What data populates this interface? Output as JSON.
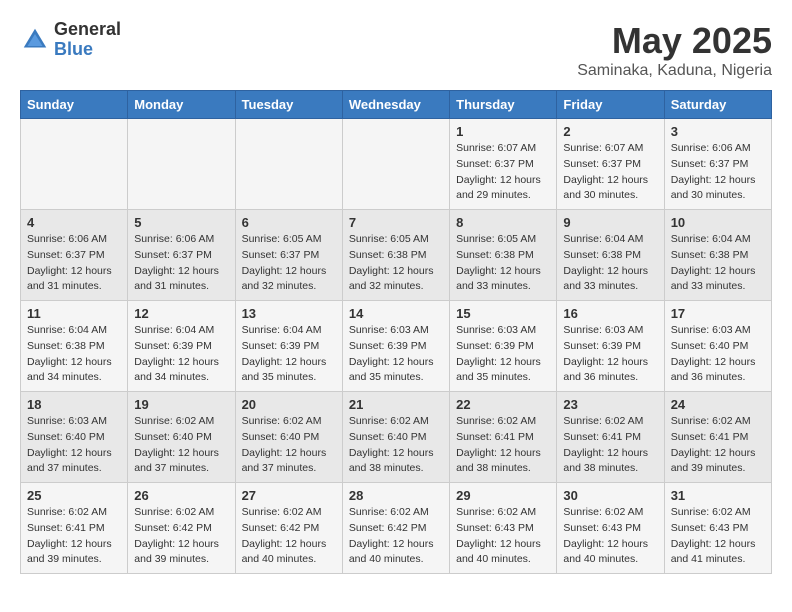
{
  "header": {
    "logo_general": "General",
    "logo_blue": "Blue",
    "month_year": "May 2025",
    "location": "Saminaka, Kaduna, Nigeria"
  },
  "days_of_week": [
    "Sunday",
    "Monday",
    "Tuesday",
    "Wednesday",
    "Thursday",
    "Friday",
    "Saturday"
  ],
  "weeks": [
    [
      {
        "day": "",
        "info": ""
      },
      {
        "day": "",
        "info": ""
      },
      {
        "day": "",
        "info": ""
      },
      {
        "day": "",
        "info": ""
      },
      {
        "day": "1",
        "info": "Sunrise: 6:07 AM\nSunset: 6:37 PM\nDaylight: 12 hours and 29 minutes."
      },
      {
        "day": "2",
        "info": "Sunrise: 6:07 AM\nSunset: 6:37 PM\nDaylight: 12 hours and 30 minutes."
      },
      {
        "day": "3",
        "info": "Sunrise: 6:06 AM\nSunset: 6:37 PM\nDaylight: 12 hours and 30 minutes."
      }
    ],
    [
      {
        "day": "4",
        "info": "Sunrise: 6:06 AM\nSunset: 6:37 PM\nDaylight: 12 hours and 31 minutes."
      },
      {
        "day": "5",
        "info": "Sunrise: 6:06 AM\nSunset: 6:37 PM\nDaylight: 12 hours and 31 minutes."
      },
      {
        "day": "6",
        "info": "Sunrise: 6:05 AM\nSunset: 6:37 PM\nDaylight: 12 hours and 32 minutes."
      },
      {
        "day": "7",
        "info": "Sunrise: 6:05 AM\nSunset: 6:38 PM\nDaylight: 12 hours and 32 minutes."
      },
      {
        "day": "8",
        "info": "Sunrise: 6:05 AM\nSunset: 6:38 PM\nDaylight: 12 hours and 33 minutes."
      },
      {
        "day": "9",
        "info": "Sunrise: 6:04 AM\nSunset: 6:38 PM\nDaylight: 12 hours and 33 minutes."
      },
      {
        "day": "10",
        "info": "Sunrise: 6:04 AM\nSunset: 6:38 PM\nDaylight: 12 hours and 33 minutes."
      }
    ],
    [
      {
        "day": "11",
        "info": "Sunrise: 6:04 AM\nSunset: 6:38 PM\nDaylight: 12 hours and 34 minutes."
      },
      {
        "day": "12",
        "info": "Sunrise: 6:04 AM\nSunset: 6:39 PM\nDaylight: 12 hours and 34 minutes."
      },
      {
        "day": "13",
        "info": "Sunrise: 6:04 AM\nSunset: 6:39 PM\nDaylight: 12 hours and 35 minutes."
      },
      {
        "day": "14",
        "info": "Sunrise: 6:03 AM\nSunset: 6:39 PM\nDaylight: 12 hours and 35 minutes."
      },
      {
        "day": "15",
        "info": "Sunrise: 6:03 AM\nSunset: 6:39 PM\nDaylight: 12 hours and 35 minutes."
      },
      {
        "day": "16",
        "info": "Sunrise: 6:03 AM\nSunset: 6:39 PM\nDaylight: 12 hours and 36 minutes."
      },
      {
        "day": "17",
        "info": "Sunrise: 6:03 AM\nSunset: 6:40 PM\nDaylight: 12 hours and 36 minutes."
      }
    ],
    [
      {
        "day": "18",
        "info": "Sunrise: 6:03 AM\nSunset: 6:40 PM\nDaylight: 12 hours and 37 minutes."
      },
      {
        "day": "19",
        "info": "Sunrise: 6:02 AM\nSunset: 6:40 PM\nDaylight: 12 hours and 37 minutes."
      },
      {
        "day": "20",
        "info": "Sunrise: 6:02 AM\nSunset: 6:40 PM\nDaylight: 12 hours and 37 minutes."
      },
      {
        "day": "21",
        "info": "Sunrise: 6:02 AM\nSunset: 6:40 PM\nDaylight: 12 hours and 38 minutes."
      },
      {
        "day": "22",
        "info": "Sunrise: 6:02 AM\nSunset: 6:41 PM\nDaylight: 12 hours and 38 minutes."
      },
      {
        "day": "23",
        "info": "Sunrise: 6:02 AM\nSunset: 6:41 PM\nDaylight: 12 hours and 38 minutes."
      },
      {
        "day": "24",
        "info": "Sunrise: 6:02 AM\nSunset: 6:41 PM\nDaylight: 12 hours and 39 minutes."
      }
    ],
    [
      {
        "day": "25",
        "info": "Sunrise: 6:02 AM\nSunset: 6:41 PM\nDaylight: 12 hours and 39 minutes."
      },
      {
        "day": "26",
        "info": "Sunrise: 6:02 AM\nSunset: 6:42 PM\nDaylight: 12 hours and 39 minutes."
      },
      {
        "day": "27",
        "info": "Sunrise: 6:02 AM\nSunset: 6:42 PM\nDaylight: 12 hours and 40 minutes."
      },
      {
        "day": "28",
        "info": "Sunrise: 6:02 AM\nSunset: 6:42 PM\nDaylight: 12 hours and 40 minutes."
      },
      {
        "day": "29",
        "info": "Sunrise: 6:02 AM\nSunset: 6:43 PM\nDaylight: 12 hours and 40 minutes."
      },
      {
        "day": "30",
        "info": "Sunrise: 6:02 AM\nSunset: 6:43 PM\nDaylight: 12 hours and 40 minutes."
      },
      {
        "day": "31",
        "info": "Sunrise: 6:02 AM\nSunset: 6:43 PM\nDaylight: 12 hours and 41 minutes."
      }
    ]
  ]
}
